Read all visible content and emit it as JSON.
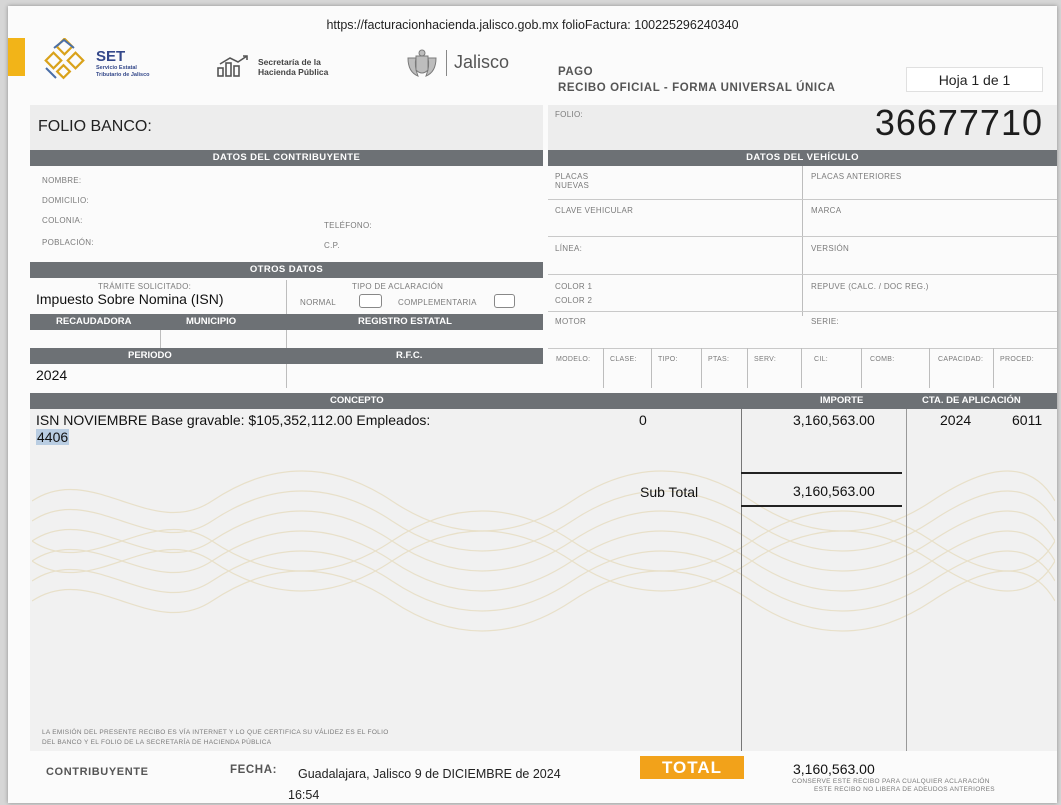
{
  "header": {
    "url_line": "https://facturacionhacienda.jalisco.gob.mx folioFactura: 100225296240340",
    "set_logo": {
      "abbr": "SET",
      "line1": "Servicio Estatal",
      "line2": "Tributario de Jalisco"
    },
    "sh_logo": {
      "line1": "Secretaría de la",
      "line2": "Hacienda Pública"
    },
    "jalisco_logo": {
      "name": "Jalisco"
    },
    "pago": "PAGO",
    "recibo": "RECIBO OFICIAL - FORMA UNIVERSAL ÚNICA",
    "hoja": "Hoja  1  de  1"
  },
  "folio_banco_label": "FOLIO BANCO:",
  "folio_label": "FOLIO:",
  "folio_value": "36677710",
  "contribuyente": {
    "title": "DATOS DEL CONTRIBUYENTE",
    "nombre": "NOMBRE:",
    "domicilio": "DOMICILIO:",
    "colonia": "COLONIA:",
    "telefono": "TELÉFONO:",
    "poblacion": "POBLACIÓN:",
    "cp": "C.P."
  },
  "otros": {
    "title": "OTROS DATOS",
    "tramite_label": "TRÁMITE SOLICITADO:",
    "tramite_value": "Impuesto Sobre Nomina (ISN)",
    "aclaracion_label": "TIPO DE ACLARACIÓN",
    "normal": "NORMAL",
    "complementaria": "COMPLEMENTARIA",
    "recaudadora": "RECAUDADORA",
    "municipio": "MUNICIPIO",
    "registro": "REGISTRO ESTATAL",
    "periodo": "PERIODO",
    "rfc": "R.F.C.",
    "periodo_value": "2024"
  },
  "vehiculo": {
    "title": "DATOS DEL VEHÍCULO",
    "placas_nuevas_1": "PLACAS",
    "placas_nuevas_2": "NUEVAS",
    "placas_anteriores": "PLACAS ANTERIORES",
    "clave": "CLAVE VEHICULAR",
    "marca": "MARCA",
    "linea": "LÍNEA:",
    "version": "VERSIÓN",
    "color1": "COLOR 1",
    "color2": "COLOR 2",
    "repuve": "REPUVE (CALC. / DOC REG.)",
    "motor": "MOTOR",
    "serie": "SERIE:",
    "cols": [
      "MODELO:",
      "CLASE:",
      "TIPO:",
      "PTAS:",
      "SERV:",
      "CIL:",
      "COMB:",
      "CAPACIDAD:",
      "PROCED:"
    ]
  },
  "concepto": {
    "head_concepto": "CONCEPTO",
    "head_importe": "IMPORTE",
    "head_cta": "CTA. DE APLICACIÓN",
    "line1": "ISN NOVIEMBRE Base gravable: $105,352,112.00 Empleados:",
    "line2": "4406",
    "zero": "0",
    "importe": "3,160,563.00",
    "cta_year": "2024",
    "cta_code": "6011",
    "subtotal_label": "Sub Total",
    "subtotal_value": "3,160,563.00"
  },
  "footer": {
    "disclaimer_1": "LA EMISIÓN DEL PRESENTE RECIBO ES VÍA INTERNET Y LO QUE CERTIFICA SU VÁLIDEZ ES EL FOLIO",
    "disclaimer_2": "DEL BANCO Y EL FOLIO DE LA SECRETARÍA DE HACIENDA PÚBLICA",
    "contribuyente": "CONTRIBUYENTE",
    "fecha_label": "FECHA:",
    "fecha_value": "Guadalajara, Jalisco 9 de DICIEMBRE de 2024",
    "hora": "16:54",
    "total_label": "TOTAL",
    "total_value": "3,160,563.00",
    "conserve_1": "CONSERVE ESTE RECIBO PARA CUALQUIER ACLARACIÓN",
    "conserve_2": "ESTE RECIBO NO LIBERA DE ADEUDOS ANTERIORES"
  },
  "colors": {
    "header_bar": "#6d7175",
    "accent_yellow": "#f2b418",
    "total_orange": "#f2a21a"
  }
}
